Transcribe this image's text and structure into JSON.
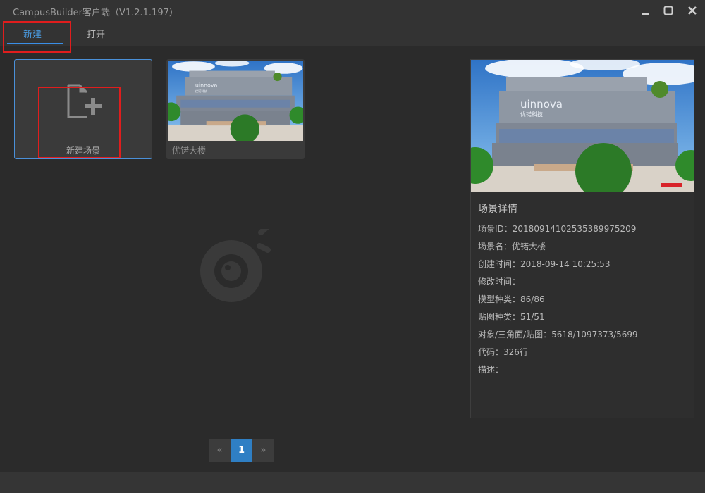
{
  "window": {
    "title": "CampusBuilder客户端（V1.2.1.197）"
  },
  "tabs": [
    {
      "label": "新建"
    },
    {
      "label": "打开"
    }
  ],
  "cards": {
    "new_scene": {
      "label": "新建场景"
    },
    "scene": {
      "label": "优锘大楼"
    }
  },
  "pagination": {
    "prev": "«",
    "current": "1",
    "next": "»"
  },
  "details": {
    "header": "场景详情",
    "rows": [
      "场景ID：20180914102535389975209",
      "场景名：优锘大楼",
      "创建时间：2018-09-14 10:25:53",
      "修改时间：-",
      "模型种类：86/86",
      "贴图种类：51/51",
      "对象/三角面/贴图：5618/1097373/5699",
      "代码：326行",
      "描述："
    ]
  },
  "thumbnail": {
    "brand_text": "uinnova",
    "brand_subtext": "优锘科技"
  },
  "colors": {
    "accent": "#3a8ee6",
    "highlight": "#e01d1d",
    "background": "#2b2b2b"
  }
}
